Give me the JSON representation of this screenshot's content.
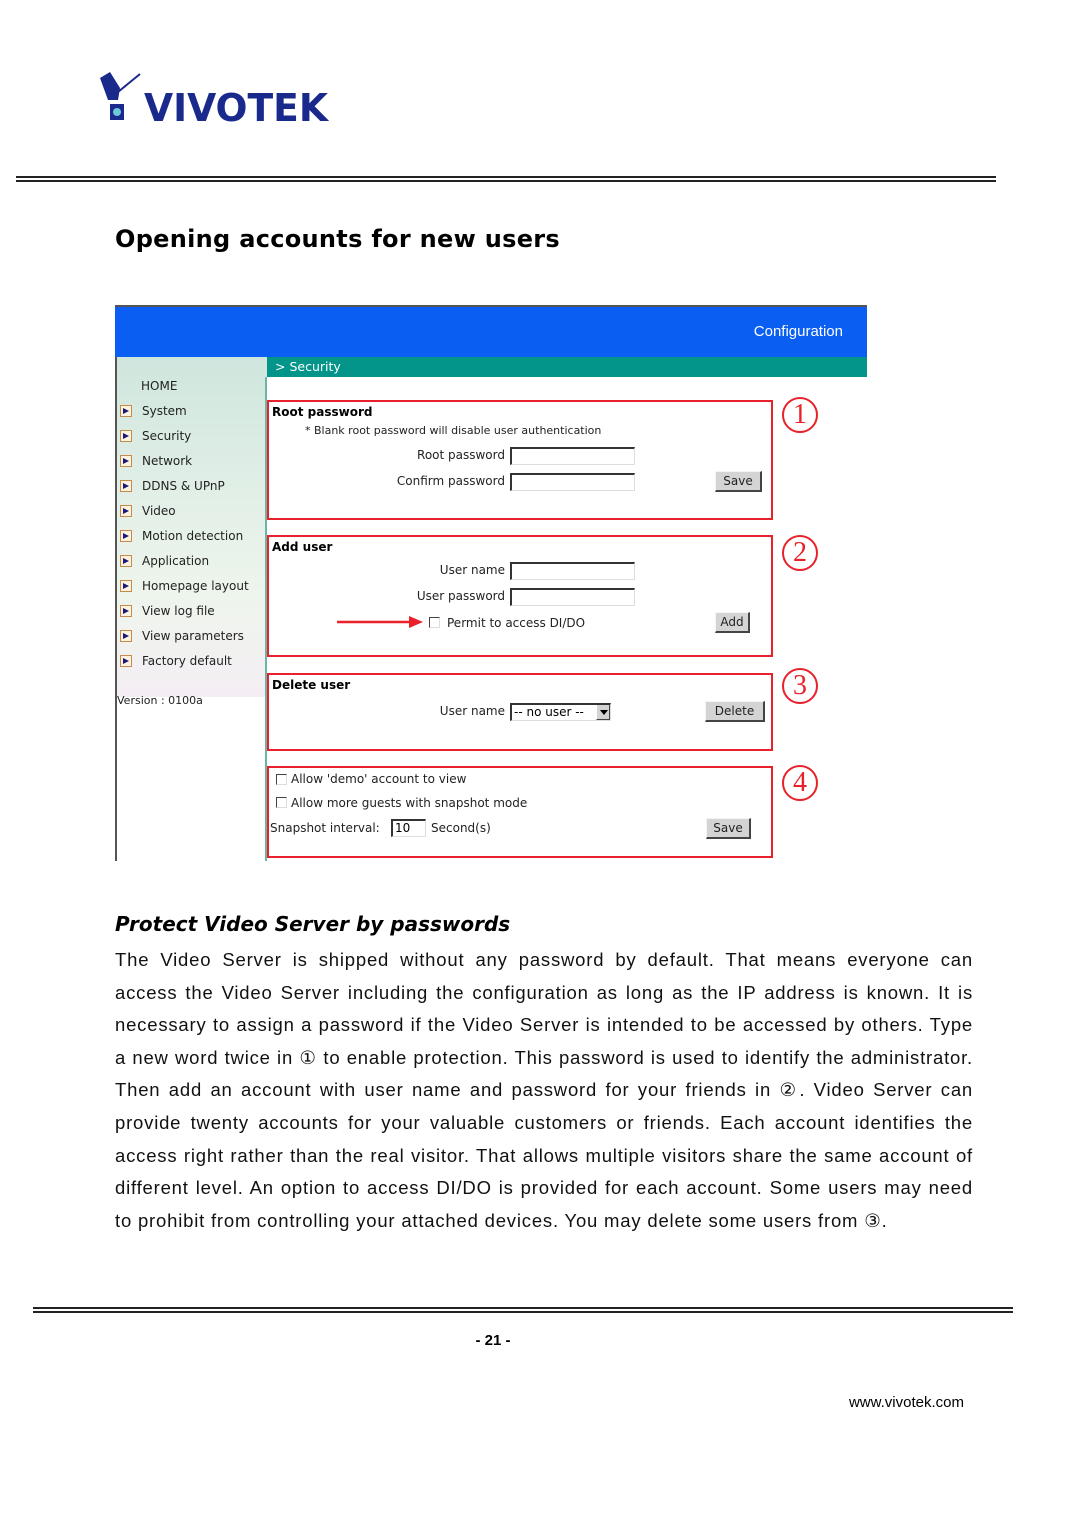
{
  "header": {
    "logo_text": "VIVOTEK"
  },
  "page_title": "Opening accounts for new users",
  "screenshot": {
    "banner_title": "Configuration",
    "breadcrumb": "> Security",
    "sidebar": {
      "home": "HOME",
      "items": [
        {
          "label": "System"
        },
        {
          "label": "Security"
        },
        {
          "label": "Network"
        },
        {
          "label": "DDNS & UPnP"
        },
        {
          "label": "Video"
        },
        {
          "label": "Motion detection"
        },
        {
          "label": "Application"
        },
        {
          "label": "Homepage layout"
        },
        {
          "label": "View log file"
        },
        {
          "label": "View parameters"
        },
        {
          "label": "Factory default"
        }
      ],
      "version": "Version : 0100a"
    },
    "root_password": {
      "title": "Root password",
      "note": "* Blank root password will disable user authentication",
      "root_label": "Root password",
      "root_value": "",
      "confirm_label": "Confirm password",
      "confirm_value": "",
      "save_label": "Save",
      "marker": "1"
    },
    "add_user": {
      "title": "Add user",
      "username_label": "User name",
      "username_value": "",
      "password_label": "User password",
      "password_value": "",
      "permit_label": "Permit to access DI/DO",
      "permit_checked": false,
      "add_label": "Add",
      "marker": "2"
    },
    "delete_user": {
      "title": "Delete user",
      "username_label": "User name",
      "selected": "-- no user --",
      "delete_label": "Delete",
      "marker": "3"
    },
    "guest_options": {
      "demo_label": "Allow 'demo' account to view",
      "demo_checked": false,
      "guests_label": "Allow more guests with snapshot mode",
      "guests_checked": false,
      "interval_label": "Snapshot interval:",
      "interval_value": "10",
      "interval_unit": "Second(s)",
      "save_label": "Save",
      "marker": "4"
    },
    "accent_colors": {
      "banner": "#0a5ff2",
      "breadcrumb_bar": "#03958a",
      "annotation": "#e8212a"
    }
  },
  "section": {
    "heading": "Protect Video Server by passwords",
    "body": "The Video Server is shipped without any password by default. That means everyone can access the Video Server including the configuration as long as the IP address is known. It is necessary to assign a password if the Video Server is intended to be accessed by others. Type a new word twice in ① to enable protection. This password is used to identify the administrator. Then add an account with user name and password for your friends in ②. Video Server can provide twenty accounts for your valuable customers or friends. Each account identifies the access right rather than the real visitor. That allows multiple visitors share the same account of different level.  An option to access DI/DO is provided for each account. Some users may need to prohibit from controlling your attached devices. You may delete some users from ③."
  },
  "footer": {
    "page_number": "- 21 -",
    "website": "www.vivotek.com"
  }
}
